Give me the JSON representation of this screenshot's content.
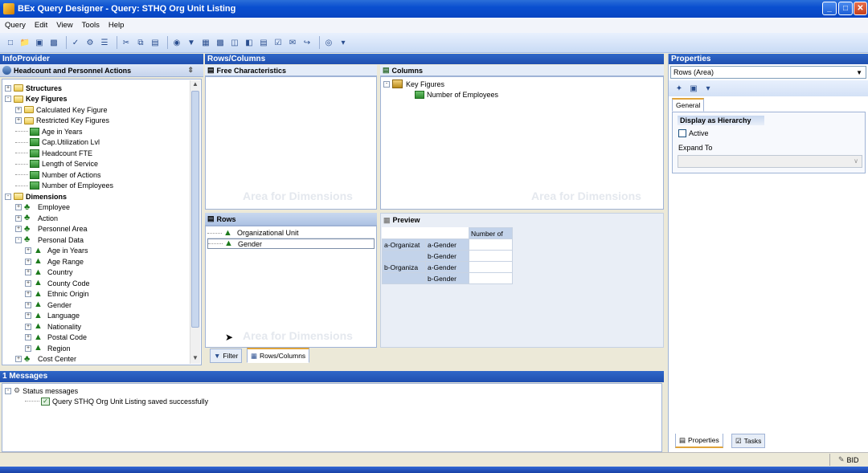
{
  "window": {
    "title": "BEx Query Designer - Query: STHQ Org Unit Listing"
  },
  "menu": [
    "Query",
    "Edit",
    "View",
    "Tools",
    "Help"
  ],
  "infoprovider": {
    "header": "InfoProvider",
    "provider_name": "Headcount and Personnel Actions",
    "tree": [
      {
        "label": "Structures",
        "type": "folder",
        "level": 0,
        "bold": true,
        "exp": "+"
      },
      {
        "label": "Key Figures",
        "type": "folder-open",
        "level": 0,
        "bold": true,
        "exp": "-"
      },
      {
        "label": "Calculated Key Figure",
        "type": "folder",
        "level": 1,
        "exp": "+"
      },
      {
        "label": "Restricted Key Figures",
        "type": "folder",
        "level": 1,
        "exp": "+"
      },
      {
        "label": "Age in Years",
        "type": "kf",
        "level": 1
      },
      {
        "label": "Cap.Utilization Lvl",
        "type": "kf",
        "level": 1
      },
      {
        "label": "Headcount FTE",
        "type": "kf",
        "level": 1
      },
      {
        "label": "Length of Service",
        "type": "kf",
        "level": 1
      },
      {
        "label": "Number of Actions",
        "type": "kf",
        "level": 1
      },
      {
        "label": "Number of Employees",
        "type": "kf",
        "level": 1
      },
      {
        "label": "Dimensions",
        "type": "folder-open",
        "level": 0,
        "bold": true,
        "exp": "-"
      },
      {
        "label": "Employee",
        "type": "dimgroup",
        "level": 1,
        "exp": "+"
      },
      {
        "label": "Action",
        "type": "dimgroup",
        "level": 1,
        "exp": "+"
      },
      {
        "label": "Personnel Area",
        "type": "dimgroup",
        "level": 1,
        "exp": "+"
      },
      {
        "label": "Personal Data",
        "type": "dimgroup",
        "level": 1,
        "exp": "-"
      },
      {
        "label": "Age in Years",
        "type": "dim",
        "level": 2,
        "exp": "+"
      },
      {
        "label": "Age Range",
        "type": "dim",
        "level": 2,
        "exp": "+"
      },
      {
        "label": "Country",
        "type": "dim",
        "level": 2,
        "exp": "+"
      },
      {
        "label": "County Code",
        "type": "dim",
        "level": 2,
        "exp": "+"
      },
      {
        "label": "Ethnic Origin",
        "type": "dim",
        "level": 2,
        "exp": "+"
      },
      {
        "label": "Gender",
        "type": "dim",
        "level": 2,
        "exp": "+"
      },
      {
        "label": "Language",
        "type": "dim",
        "level": 2,
        "exp": "+"
      },
      {
        "label": "Nationality",
        "type": "dim",
        "level": 2,
        "exp": "+"
      },
      {
        "label": "Postal Code",
        "type": "dim",
        "level": 2,
        "exp": "+"
      },
      {
        "label": "Region",
        "type": "dim",
        "level": 2,
        "exp": "+"
      },
      {
        "label": "Cost Center",
        "type": "dimgroup",
        "level": 1,
        "exp": "+"
      }
    ]
  },
  "rowscols": {
    "header": "Rows/Columns",
    "free_chars": {
      "title": "Free Characteristics",
      "ghost": "Area for Dimensions"
    },
    "columns": {
      "title": "Columns",
      "ghost": "Area for Dimensions",
      "items": [
        {
          "label": "Key Figures"
        },
        {
          "label": "Number of Employees"
        }
      ]
    },
    "rows": {
      "title": "Rows",
      "ghost": "Area for Dimensions",
      "items": [
        "Organizational Unit",
        "Gender"
      ]
    },
    "preview": {
      "title": "Preview",
      "col_header": "Number of",
      "rows": [
        [
          "a-Organizat",
          "a-Gender"
        ],
        [
          "",
          "b-Gender"
        ],
        [
          "b-Organiza",
          "a-Gender"
        ],
        [
          "",
          "b-Gender"
        ]
      ]
    },
    "tabs": [
      "Filter",
      "Rows/Columns"
    ]
  },
  "properties": {
    "header": "Properties",
    "dropdown": "Rows (Area)",
    "tab": "General",
    "section": "Display as Hierarchy",
    "active_label": "Active",
    "expand_label": "Expand To",
    "bottom_tabs": [
      "Properties",
      "Tasks"
    ]
  },
  "messages": {
    "header": "1 Messages",
    "group": "Status messages",
    "items": [
      "Query STHQ Org Unit Listing saved successfully"
    ]
  },
  "statusbar": {
    "right": "BID"
  }
}
